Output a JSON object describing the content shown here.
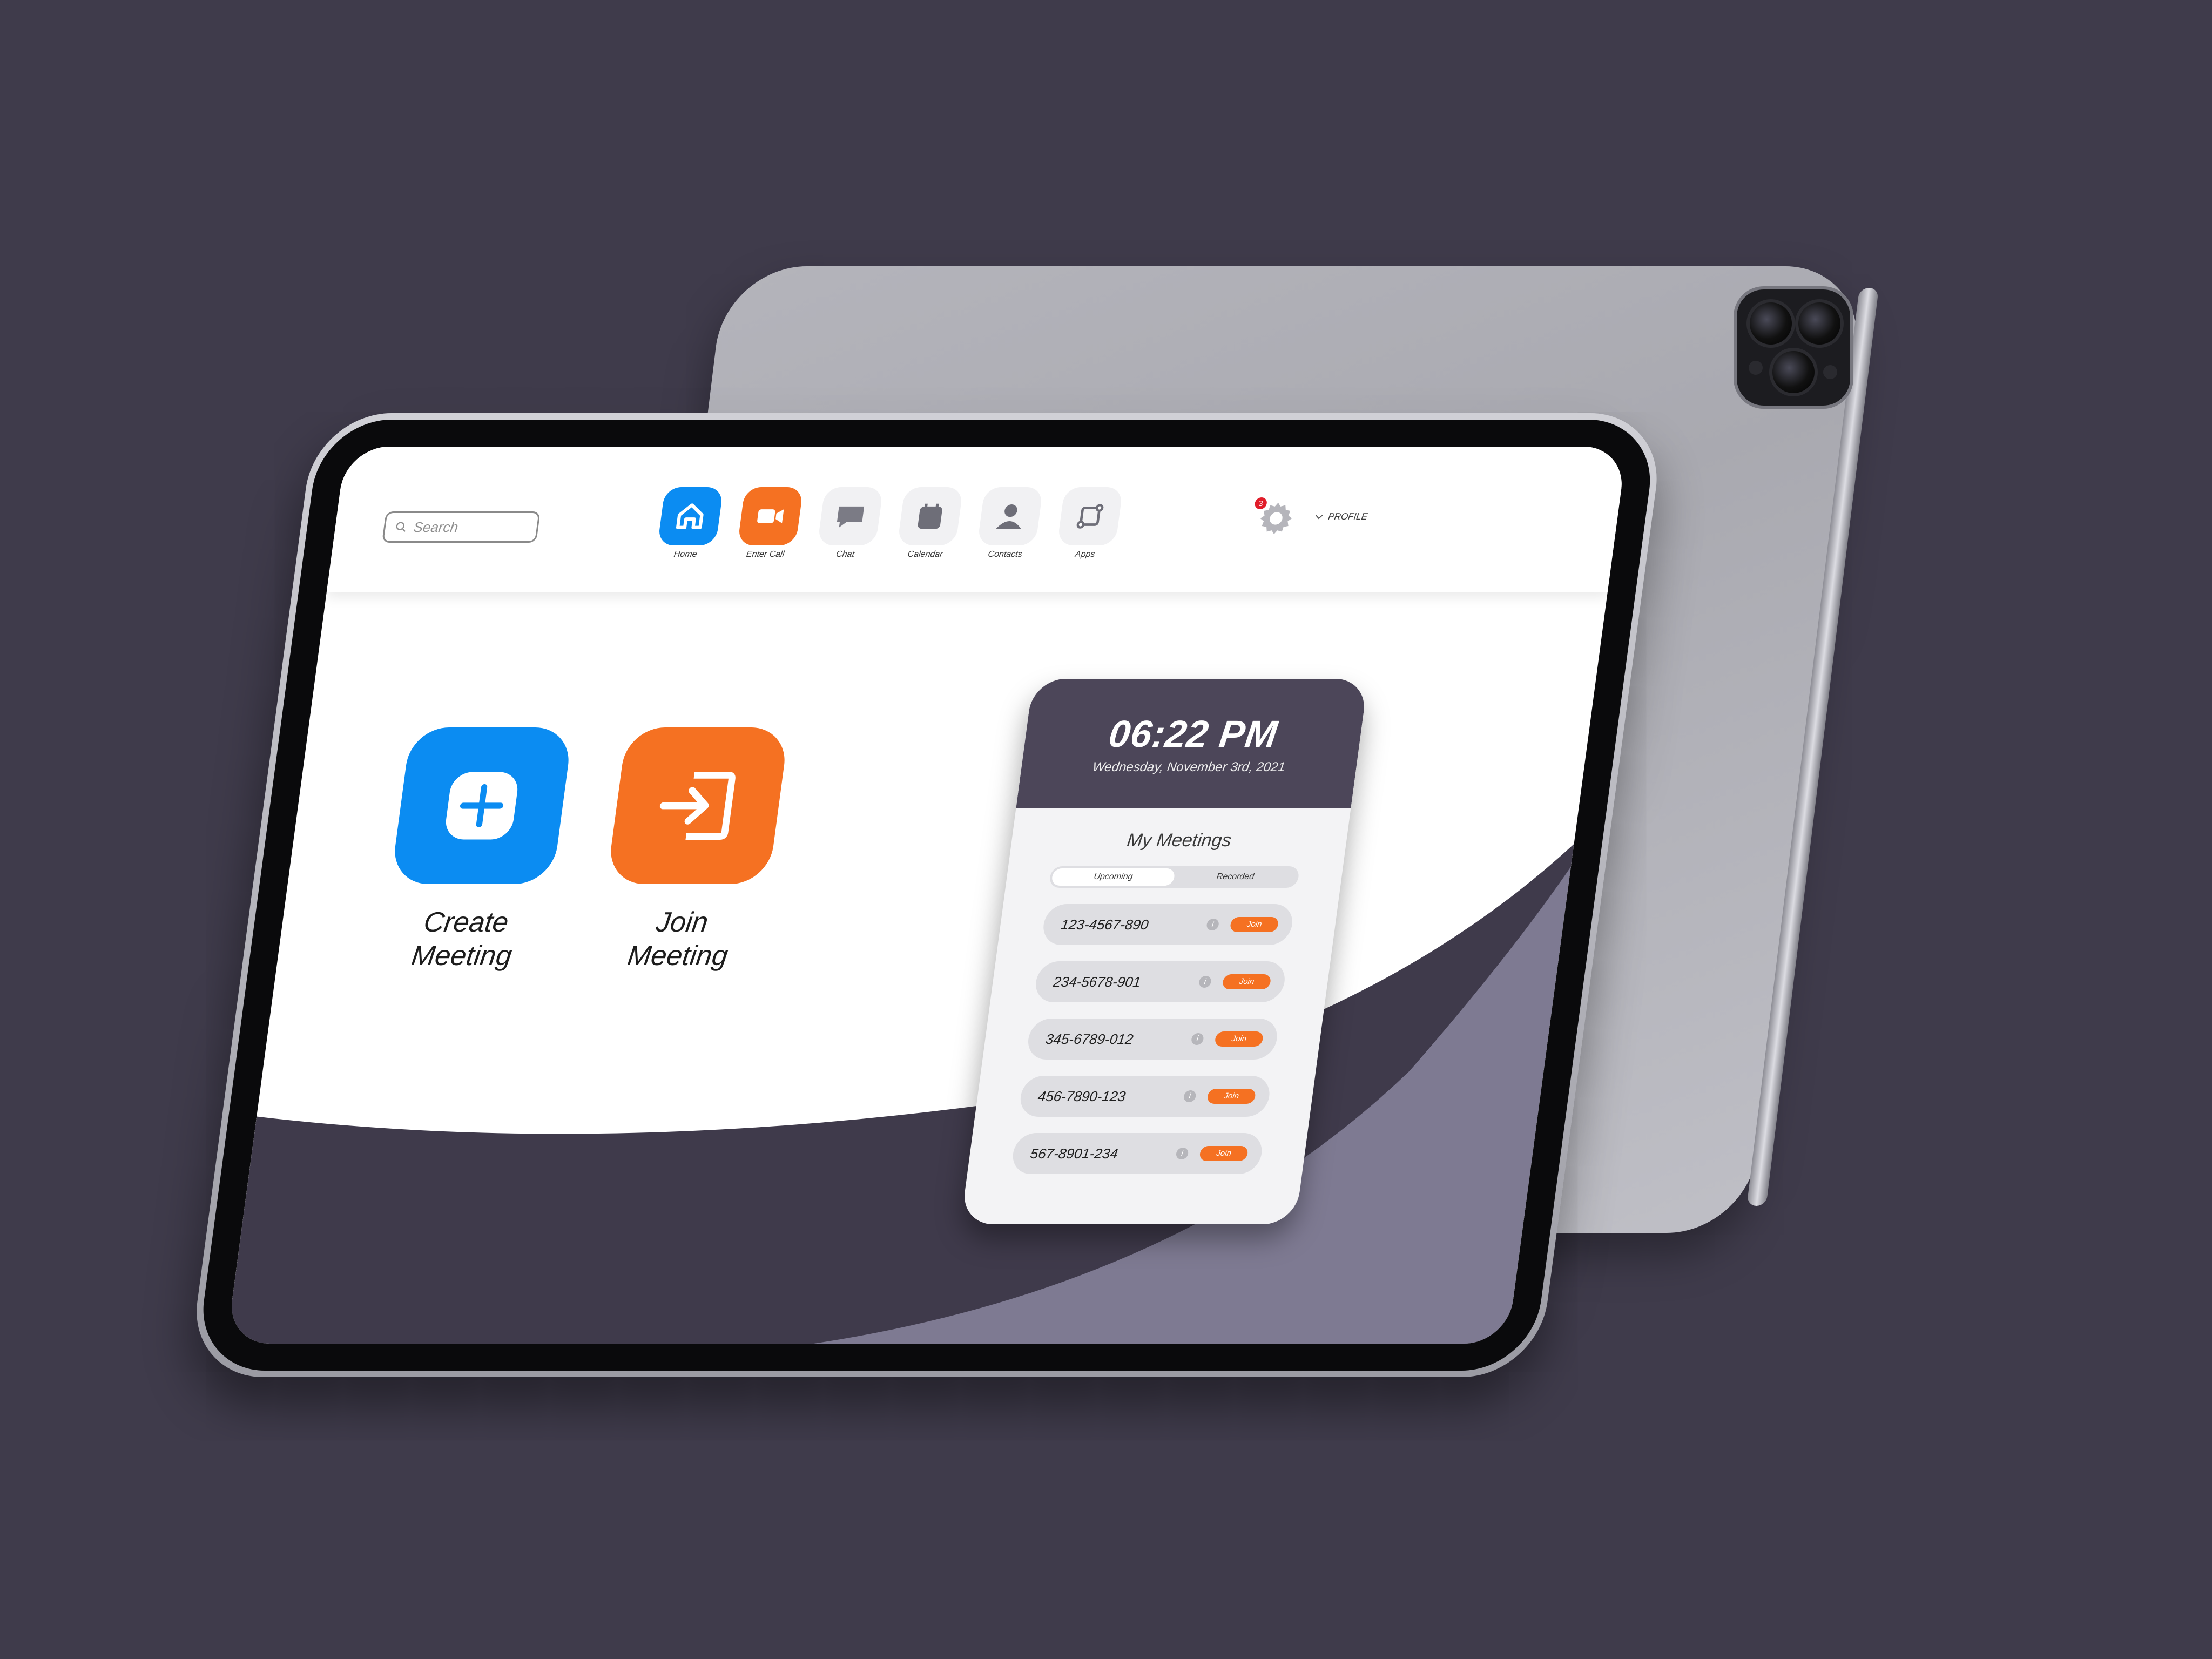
{
  "search": {
    "placeholder": "Search"
  },
  "nav": [
    {
      "label": "Home",
      "icon": "home-icon"
    },
    {
      "label": "Enter Call",
      "icon": "video-camera-icon"
    },
    {
      "label": "Chat",
      "icon": "chat-bubble-icon"
    },
    {
      "label": "Calendar",
      "icon": "calendar-icon",
      "day": "3"
    },
    {
      "label": "Contacts",
      "icon": "contacts-icon"
    },
    {
      "label": "Apps",
      "icon": "apps-icon"
    }
  ],
  "settings": {
    "badge": "3",
    "icon": "gear-icon"
  },
  "profile": {
    "label": "PROFILE",
    "icon": "chevron-down-icon"
  },
  "actions": {
    "create_line1": "Create",
    "create_line2": "Meeting",
    "join_line1": "Join",
    "join_line2": "Meeting"
  },
  "card": {
    "time": "06:22 PM",
    "date": "Wednesday, November 3rd, 2021",
    "title": "My Meetings",
    "tabs": [
      "Upcoming",
      "Recorded"
    ],
    "meetings": [
      {
        "id": "123-4567-890",
        "action": "Join"
      },
      {
        "id": "234-5678-901",
        "action": "Join"
      },
      {
        "id": "345-6789-012",
        "action": "Join"
      },
      {
        "id": "456-7890-123",
        "action": "Join"
      },
      {
        "id": "567-8901-234",
        "action": "Join"
      }
    ]
  },
  "colors": {
    "background": "#3f3b4b",
    "accent_blue": "#0b8cf2",
    "accent_orange": "#f57122",
    "card_header": "#4c4659",
    "purple_dark": "#3f3a4b",
    "purple_light": "#7e7a92"
  }
}
